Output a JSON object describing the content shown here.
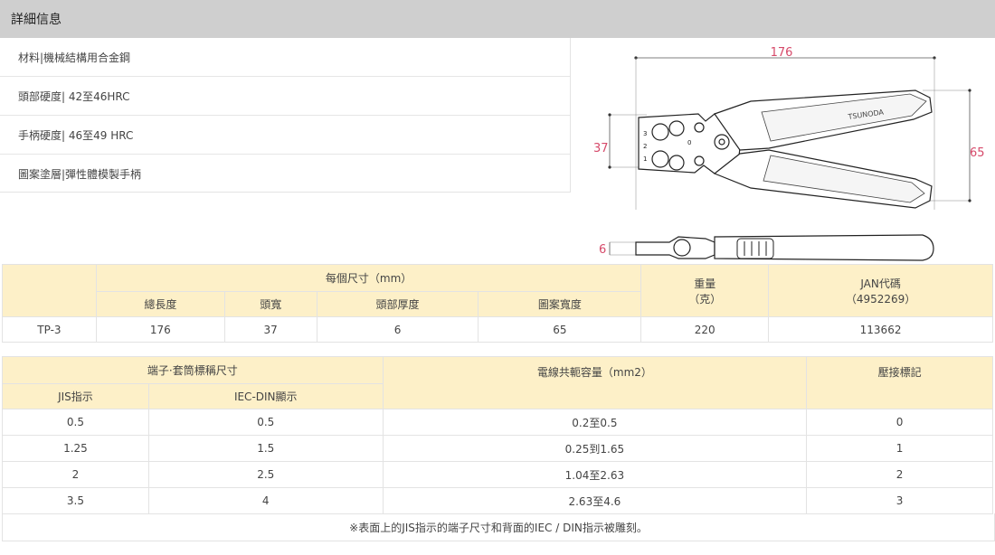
{
  "header": {
    "title": "詳細信息"
  },
  "specs": [
    "材料|機械結構用合金鋼",
    "頭部硬度| 42至46HRC",
    "手柄硬度| 46至49 HRC",
    "圖案塗層|彈性體模製手柄"
  ],
  "diagram": {
    "dim_length": "176",
    "dim_head_width": "37",
    "dim_height": "65",
    "dim_thickness": "6",
    "brand": "TSUNODA",
    "jaw_marks": [
      "3",
      "2",
      "1",
      "0"
    ],
    "accent_color": "#d64a6a"
  },
  "table1": {
    "group_header": "每個尺寸（mm）",
    "weight_header": "重量",
    "weight_unit": "（克）",
    "jan_header": "JAN代碼",
    "jan_prefix": "（4952269）",
    "sub_headers": [
      "總長度",
      "頭寬",
      "頭部厚度",
      "圖案寬度"
    ],
    "row": {
      "model": "TP-3",
      "length": "176",
      "head_width": "37",
      "head_thickness": "6",
      "pattern_width": "65",
      "weight": "220",
      "jan": "113662"
    }
  },
  "table2": {
    "group_header": "端子·套筒標稱尺寸",
    "sub_jis": "JIS指示",
    "sub_iec": "IEC-DIN顯示",
    "wire_header": "電線共軛容量（mm2）",
    "mark_header": "壓接標記",
    "rows": [
      {
        "jis": "0.5",
        "iec": "0.5",
        "wire": "0.2至0.5",
        "mark": "0"
      },
      {
        "jis": "1.25",
        "iec": "1.5",
        "wire": "0.25到1.65",
        "mark": "1"
      },
      {
        "jis": "2",
        "iec": "2.5",
        "wire": "1.04至2.63",
        "mark": "2"
      },
      {
        "jis": "3.5",
        "iec": "4",
        "wire": "2.63至4.6",
        "mark": "3"
      }
    ],
    "note": "※表面上的JIS指示的端子尺寸和背面的IEC / DIN指示被雕刻。"
  }
}
